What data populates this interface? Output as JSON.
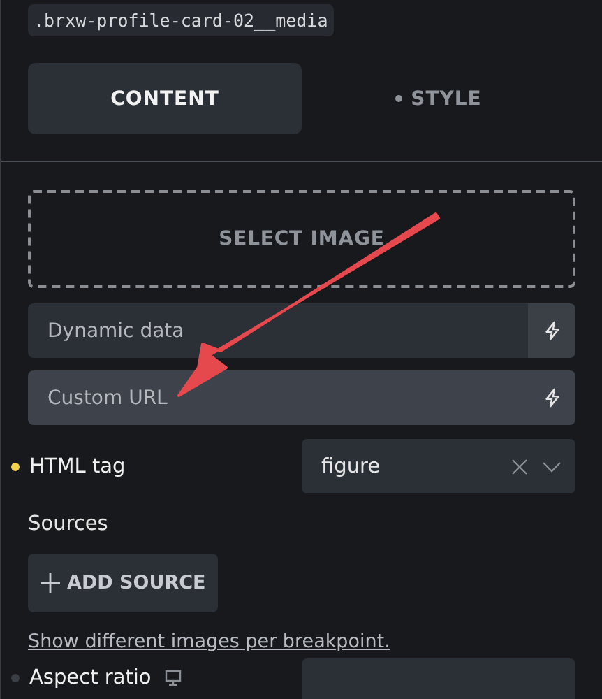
{
  "selector": ".brxw-profile-card-02__media",
  "tabs": [
    {
      "label": "CONTENT",
      "selected": true,
      "dot": false
    },
    {
      "label": "STYLE",
      "selected": false,
      "dot": true
    }
  ],
  "image_picker": {
    "label": "SELECT IMAGE"
  },
  "fields": [
    {
      "placeholder": "Dynamic data",
      "highlighted": false
    },
    {
      "placeholder": "Custom URL",
      "highlighted": true
    }
  ],
  "html_tag": {
    "label": "HTML tag",
    "modified": true,
    "value": "figure"
  },
  "sources": {
    "label": "Sources",
    "button": "ADD SOURCE",
    "link": "Show different images per breakpoint."
  },
  "aspect_ratio": {
    "label": "Aspect ratio",
    "modified": false
  }
}
